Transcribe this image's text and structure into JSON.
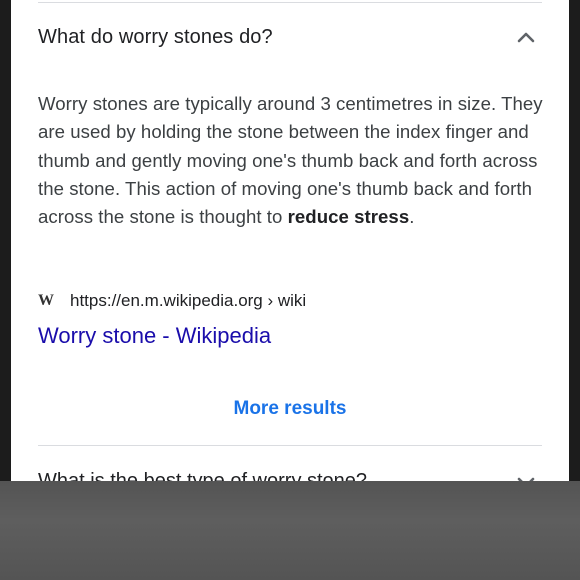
{
  "faq": {
    "question": "What do worry stones do?",
    "answer_text": "Worry stones are typically around 3 centimetres in size. They are used by holding the stone between the index finger and thumb and gently moving one's thumb back and forth across the stone. This action of moving one's thumb back and forth across the stone is thought to ",
    "answer_bold": "reduce stress",
    "answer_end": ".",
    "expand_icon": "chevron-up-icon"
  },
  "source": {
    "icon": "wikipedia-icon",
    "icon_text": "W",
    "url": "https://en.m.wikipedia.org › wiki",
    "link_title": "Worry stone - Wikipedia"
  },
  "more_results_label": "More results",
  "next_faq": {
    "question": "What is the best type of worry stone?",
    "expand_icon": "chevron-down-icon"
  },
  "colors": {
    "link": "#1a0dab",
    "accent": "#1a73e8",
    "text": "#202124",
    "background": "#ffffff"
  }
}
